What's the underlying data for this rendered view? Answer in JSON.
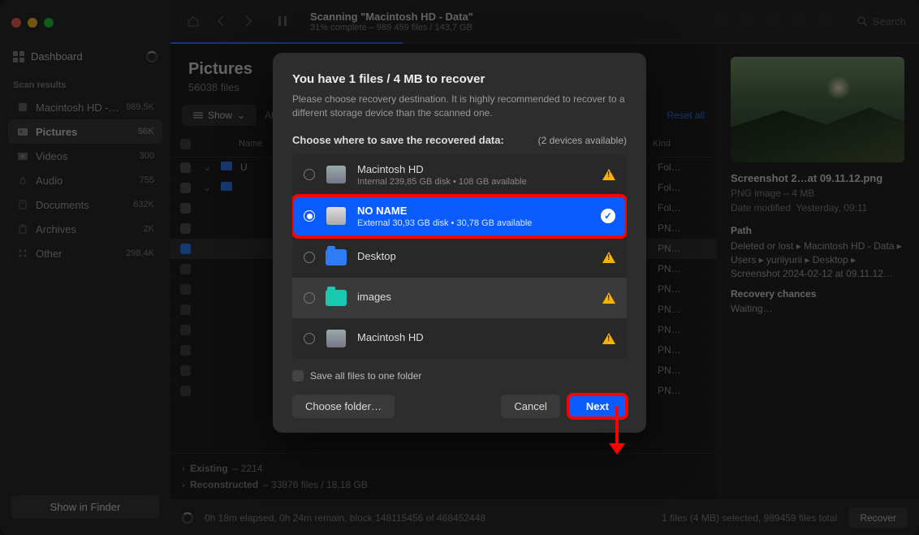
{
  "topbar": {
    "title": "Scanning \"Macintosh HD - Data\"",
    "subtitle": "31% complete – 989 459 files / 143,7 GB",
    "search_placeholder": "Search",
    "progress_pct": 31
  },
  "sidebar": {
    "dashboard": "Dashboard",
    "scan_header": "Scan results",
    "items": [
      {
        "label": "Macintosh HD -…",
        "count": "989,5K"
      },
      {
        "label": "Pictures",
        "count": "56K"
      },
      {
        "label": "Videos",
        "count": "300"
      },
      {
        "label": "Audio",
        "count": "755"
      },
      {
        "label": "Documents",
        "count": "632K"
      },
      {
        "label": "Archives",
        "count": "2K"
      },
      {
        "label": "Other",
        "count": "298,4K"
      }
    ],
    "show_in_finder": "Show in Finder"
  },
  "section": {
    "title": "Pictures",
    "subtitle": "56038 files",
    "filter_show": "Show",
    "filter_all": "All recovery chances",
    "reset": "Reset all"
  },
  "table": {
    "headers": {
      "name": "Name",
      "kind": "Kind"
    },
    "rows": [
      {
        "name": "U",
        "kind": "Fol…",
        "expand": true,
        "check": "dash"
      },
      {
        "name": "",
        "kind": "Fol…",
        "expand": true,
        "check": "dash"
      },
      {
        "name": "",
        "kind": "Fol…",
        "check": "dash"
      },
      {
        "name": "",
        "kind": "PN…",
        "check": "dash"
      },
      {
        "name": "",
        "kind": "PN…",
        "check": "chk",
        "sel": true
      },
      {
        "name": "",
        "kind": "PN…"
      },
      {
        "name": "",
        "kind": "PN…"
      },
      {
        "name": "",
        "kind": "PN…"
      },
      {
        "name": "",
        "kind": "PN…"
      },
      {
        "name": "",
        "kind": "PN…"
      },
      {
        "name": "",
        "kind": "PN…"
      },
      {
        "name": "",
        "kind": "PN…"
      }
    ],
    "footer": {
      "existing": "Existing",
      "existing_val": "– 2214",
      "reconstructed": "Reconstructed",
      "reconstructed_val": "– 33876 files / 18,18 GB"
    }
  },
  "preview": {
    "filename": "Screenshot 2…at 09.11.12.png",
    "kind": "PNG image – 4 MB",
    "modified_label": "Date modified",
    "modified_val": "Yesterday, 09:11",
    "path_label": "Path",
    "path_val": "Deleted or lost ▸ Macintosh HD - Data ▸ Users ▸ yuriiyurii ▸ Desktop ▸ Screenshot 2024-02-12 at 09.11.12…",
    "rec_label": "Recovery chances",
    "rec_val": "Waiting…"
  },
  "statusbar": {
    "elapsed": "0h 18m elapsed, 0h 24m remain, block 148115456 of 468452448",
    "selected": "1 files (4 MB) selected, 989459 files total",
    "recover": "Recover"
  },
  "modal": {
    "title": "You have 1 files / 4 MB to recover",
    "desc": "Please choose recovery destination. It is highly recommended to recover to a different storage device than the scanned one.",
    "choose": "Choose where to save the recovered data:",
    "available": "(2 devices available)",
    "dests": [
      {
        "name": "Macintosh HD",
        "sub": "Internal 239,85 GB disk • 108 GB available",
        "ico": "hdd",
        "warn": true
      },
      {
        "name": "NO NAME",
        "sub": "External 30,93 GB disk • 30,78 GB available",
        "ico": "ext",
        "selected": true
      },
      {
        "name": "Desktop",
        "sub": "",
        "ico": "folder-blue",
        "warn": true
      },
      {
        "name": "images",
        "sub": "",
        "ico": "folder-teal",
        "warn": true,
        "hilite": true
      },
      {
        "name": "Macintosh HD",
        "sub": "",
        "ico": "hdd",
        "warn": true
      }
    ],
    "save_all": "Save all files to one folder",
    "choose_folder": "Choose folder…",
    "cancel": "Cancel",
    "next": "Next"
  }
}
